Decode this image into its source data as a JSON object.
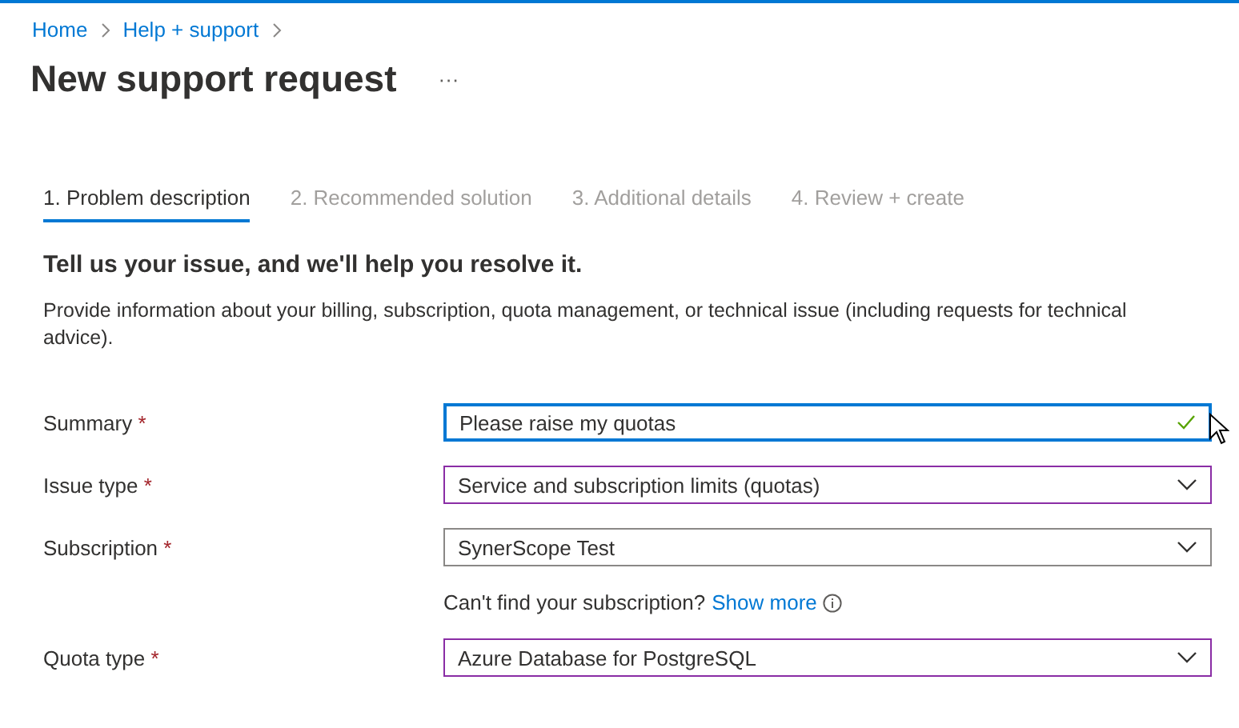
{
  "breadcrumb": [
    "Home",
    "Help + support"
  ],
  "title": "New support request",
  "more_button": "···",
  "tabs": [
    {
      "label": "1. Problem description",
      "selected": true
    },
    {
      "label": "2. Recommended solution",
      "selected": false
    },
    {
      "label": "3. Additional details",
      "selected": false
    },
    {
      "label": "4. Review + create",
      "selected": false
    }
  ],
  "heading": "Tell us your issue, and we'll help you resolve it.",
  "description": "Provide information about your billing, subscription, quota management, or technical issue (including requests for technical advice).",
  "rows": [
    {
      "kind": "text",
      "label": "Summary",
      "required_mark": "*",
      "value": "Please raise my quotas",
      "focused": true,
      "valid": true
    },
    {
      "kind": "dropdown",
      "label": "Issue type",
      "required_mark": "*",
      "value": "Service and subscription limits (quotas)",
      "focused": false,
      "modified": true
    },
    {
      "kind": "dropdown",
      "label": "Subscription",
      "required_mark": "*",
      "value": "SynerScope Test",
      "focused": false,
      "modified": false
    },
    {
      "kind": "hint",
      "text": "Can't find your subscription?",
      "link": "Show more"
    },
    {
      "kind": "dropdown",
      "label": "Quota type",
      "required_mark": "*",
      "value": "Azure Database for PostgreSQL",
      "focused": false,
      "modified": true
    }
  ]
}
